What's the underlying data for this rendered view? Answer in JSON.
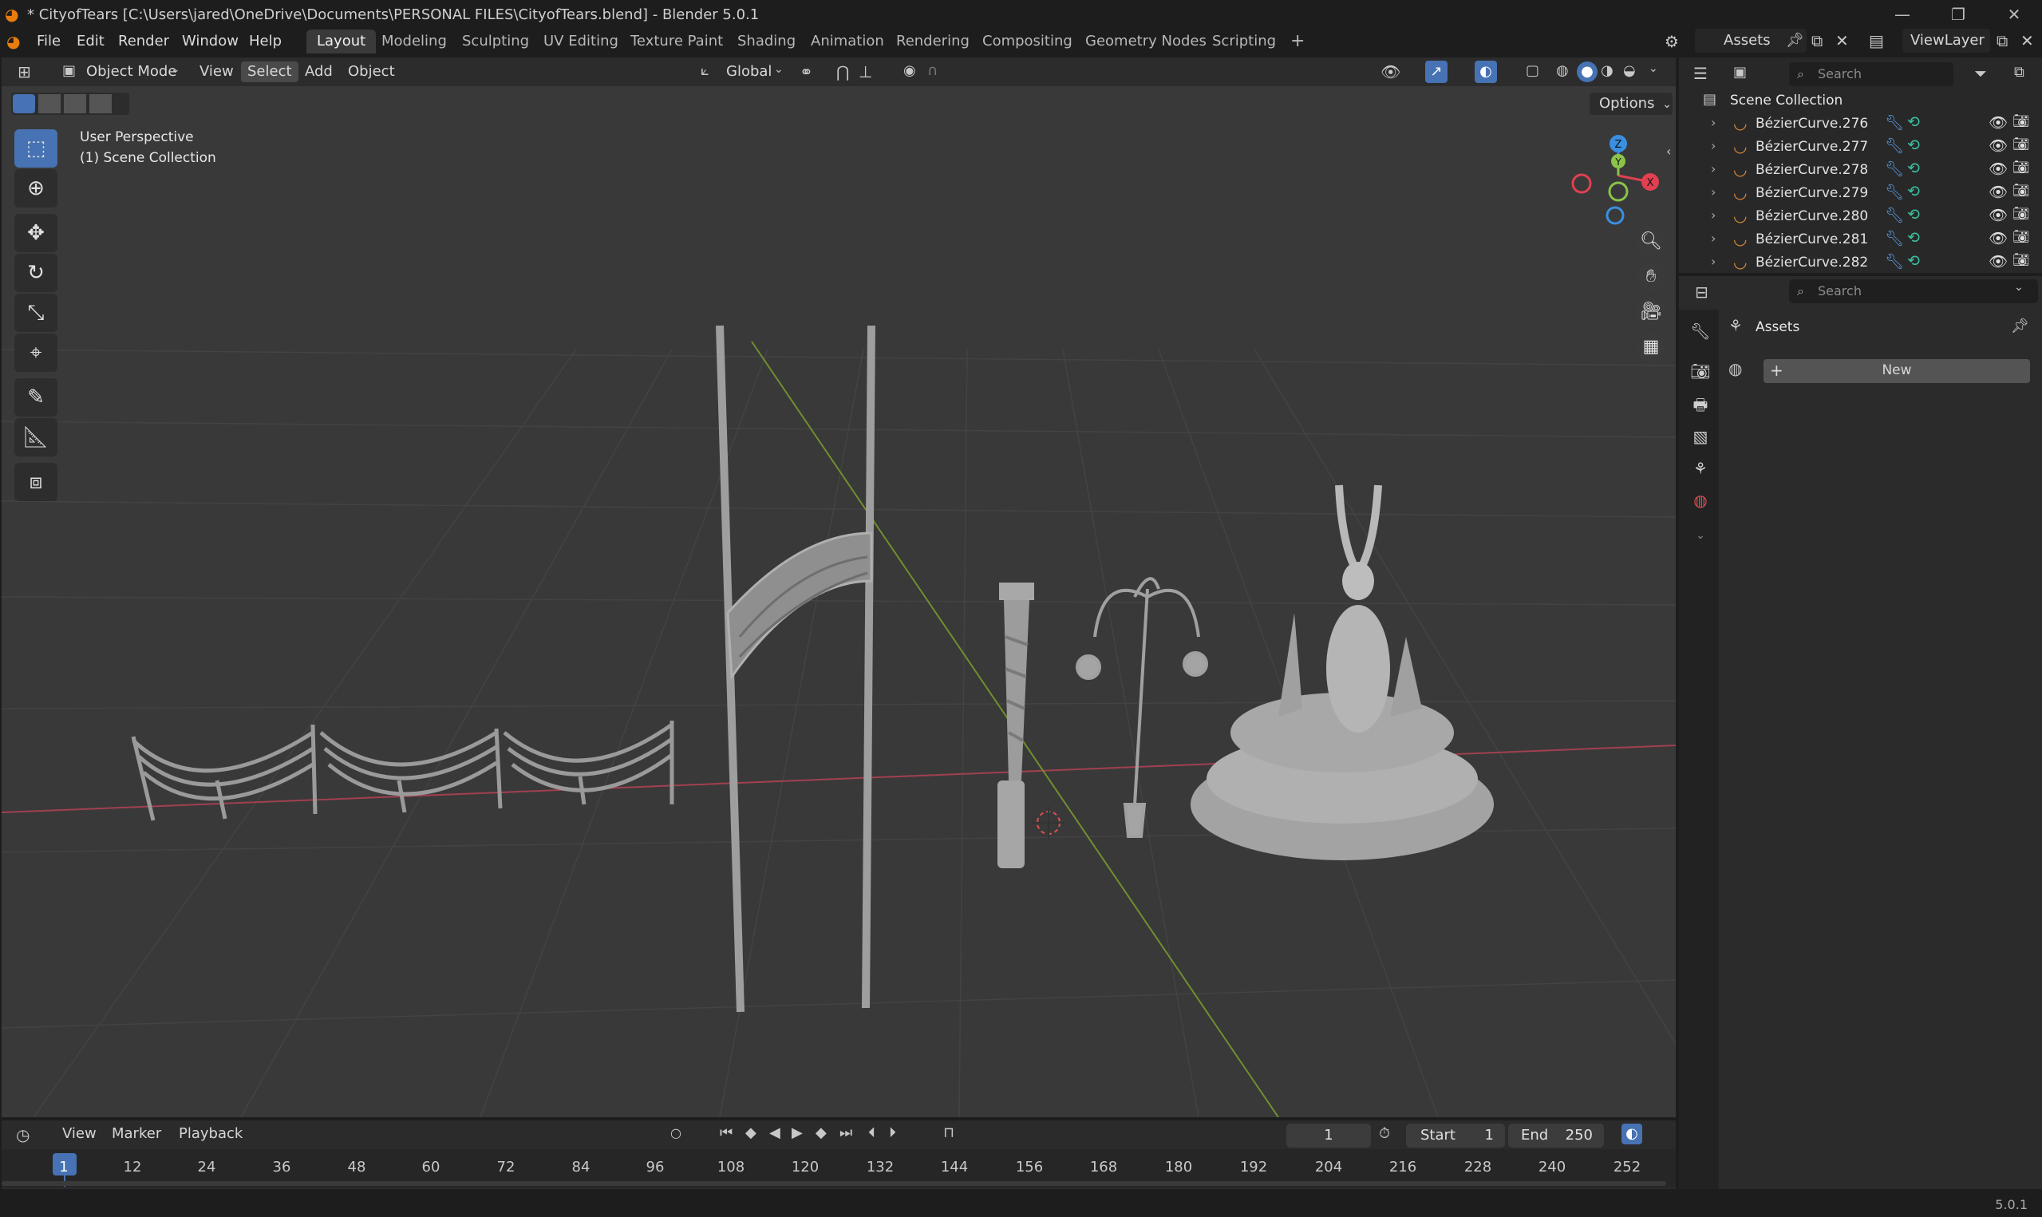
{
  "window": {
    "title": "* CityofTears [C:\\Users\\jared\\OneDrive\\Documents\\PERSONAL FILES\\CityofTears.blend] - Blender 5.0.1"
  },
  "menu": [
    "File",
    "Edit",
    "Render",
    "Window",
    "Help"
  ],
  "workspaces": [
    "Layout",
    "Modeling",
    "Sculpting",
    "UV Editing",
    "Texture Paint",
    "Shading",
    "Animation",
    "Rendering",
    "Compositing",
    "Geometry Nodes",
    "Scripting"
  ],
  "active_workspace": "Layout",
  "scene_selector": "Assets",
  "view_layer": "ViewLayer",
  "viewport": {
    "mode": "Object Mode",
    "menus": [
      "View",
      "Select",
      "Add",
      "Object"
    ],
    "transform_orientation": "Global",
    "options_label": "Options",
    "overlay_line1": "User Perspective",
    "overlay_line2": "(1) Scene Collection",
    "gizmo_labels": {
      "z": "Z",
      "y": "Y",
      "x": "X"
    }
  },
  "tools": [
    "select-box-icon",
    "cursor-icon",
    "move-icon",
    "rotate-icon",
    "scale-icon",
    "transform-icon",
    "annotate-icon",
    "measure-icon",
    "add-cube-icon"
  ],
  "outliner": {
    "search_placeholder": "Search",
    "root": "Scene Collection",
    "items": [
      "BézierCurve.276",
      "BézierCurve.277",
      "BézierCurve.278",
      "BézierCurve.279",
      "BézierCurve.280",
      "BézierCurve.281",
      "BézierCurve.282"
    ]
  },
  "properties": {
    "search_placeholder": "Search",
    "title": "Assets",
    "new_label": "New"
  },
  "timeline": {
    "menus": [
      "View",
      "Marker",
      "Playback"
    ],
    "current_frame": "1",
    "start_label": "Start",
    "start": "1",
    "end_label": "End",
    "end": "250",
    "ticks": [
      "1",
      "12",
      "24",
      "36",
      "48",
      "60",
      "72",
      "84",
      "96",
      "108",
      "120",
      "132",
      "144",
      "156",
      "168",
      "180",
      "192",
      "204",
      "216",
      "228",
      "240",
      "252"
    ]
  },
  "status": {
    "version": "5.0.1"
  },
  "colors": {
    "accent": "#4772b3",
    "x_axis": "#e04050",
    "y_axis": "#8bc34a",
    "z_axis": "#3a8fe0",
    "curve": "#e08a3a"
  }
}
